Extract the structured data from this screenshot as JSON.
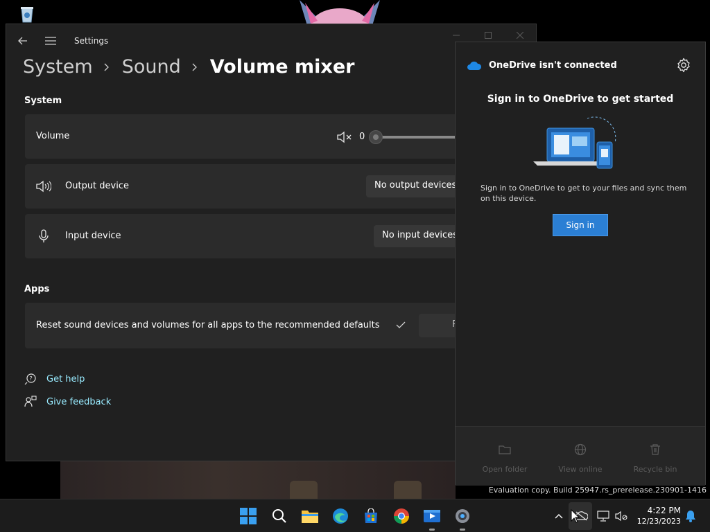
{
  "settings": {
    "title": "Settings",
    "breadcrumb": [
      "System",
      "Sound",
      "Volume mixer"
    ],
    "system_section": "System",
    "volume": {
      "label": "Volume",
      "value": "0",
      "level": 0
    },
    "output_device": {
      "label": "Output device",
      "value": "No output devices"
    },
    "input_device": {
      "label": "Input device",
      "value": "No input devices"
    },
    "apps_section": "Apps",
    "reset": {
      "label": "Reset sound devices and volumes for all apps to the recommended defaults",
      "button": "R"
    },
    "help": "Get help",
    "feedback": "Give feedback"
  },
  "onedrive": {
    "title": "OneDrive isn't connected",
    "heading": "Sign in to OneDrive to get started",
    "description": "Sign in to OneDrive to get to your files and sync them on this device.",
    "signin": "Sign in",
    "footer": [
      "Open folder",
      "View online",
      "Recycle bin"
    ]
  },
  "watermark": "Evaluation copy. Build 25947.rs_prerelease.230901-1416",
  "taskbar": {
    "time": "4:22 PM",
    "date": "12/23/2023",
    "apps": [
      "start-icon",
      "search-icon",
      "file-explorer-icon",
      "edge-icon",
      "store-icon",
      "chrome-icon",
      "clipchamp-icon",
      "settings-icon"
    ]
  },
  "colors": {
    "accent": "#2b7fd4",
    "link": "#99ebff",
    "window_bg": "#202020",
    "card_bg": "#2b2b2b"
  }
}
